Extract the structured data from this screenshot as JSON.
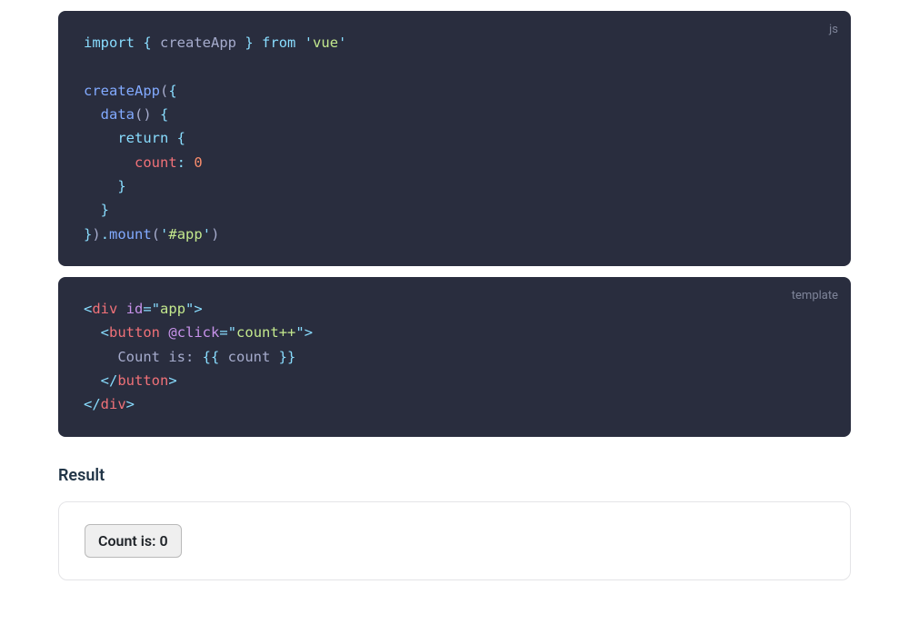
{
  "codeBlocks": {
    "js": {
      "lang": "js",
      "tokens": [
        [
          {
            "t": "keyword",
            "v": "import"
          },
          {
            "t": "default",
            "v": " "
          },
          {
            "t": "punct",
            "v": "{"
          },
          {
            "t": "default",
            "v": " createApp "
          },
          {
            "t": "punct",
            "v": "}"
          },
          {
            "t": "default",
            "v": " "
          },
          {
            "t": "keyword",
            "v": "from"
          },
          {
            "t": "default",
            "v": " "
          },
          {
            "t": "punct",
            "v": "'"
          },
          {
            "t": "string",
            "v": "vue"
          },
          {
            "t": "punct",
            "v": "'"
          }
        ],
        [],
        [
          {
            "t": "func",
            "v": "createApp"
          },
          {
            "t": "default",
            "v": "("
          },
          {
            "t": "punct",
            "v": "{"
          }
        ],
        [
          {
            "t": "default",
            "v": "  "
          },
          {
            "t": "func",
            "v": "data"
          },
          {
            "t": "default",
            "v": "()"
          },
          {
            "t": "default",
            "v": " "
          },
          {
            "t": "punct",
            "v": "{"
          }
        ],
        [
          {
            "t": "default",
            "v": "    "
          },
          {
            "t": "keyword",
            "v": "return"
          },
          {
            "t": "default",
            "v": " "
          },
          {
            "t": "punct",
            "v": "{"
          }
        ],
        [
          {
            "t": "default",
            "v": "      "
          },
          {
            "t": "prop",
            "v": "count"
          },
          {
            "t": "punct",
            "v": ":"
          },
          {
            "t": "default",
            "v": " "
          },
          {
            "t": "num",
            "v": "0"
          }
        ],
        [
          {
            "t": "default",
            "v": "    "
          },
          {
            "t": "punct",
            "v": "}"
          }
        ],
        [
          {
            "t": "default",
            "v": "  "
          },
          {
            "t": "punct",
            "v": "}"
          }
        ],
        [
          {
            "t": "punct",
            "v": "}"
          },
          {
            "t": "default",
            "v": ")"
          },
          {
            "t": "punct",
            "v": "."
          },
          {
            "t": "func",
            "v": "mount"
          },
          {
            "t": "default",
            "v": "("
          },
          {
            "t": "punct",
            "v": "'"
          },
          {
            "t": "string",
            "v": "#app"
          },
          {
            "t": "punct",
            "v": "'"
          },
          {
            "t": "default",
            "v": ")"
          }
        ]
      ]
    },
    "template": {
      "lang": "template",
      "tokens": [
        [
          {
            "t": "tagbr",
            "v": "<"
          },
          {
            "t": "tagname",
            "v": "div"
          },
          {
            "t": "default",
            "v": " "
          },
          {
            "t": "attr",
            "v": "id"
          },
          {
            "t": "tagbr",
            "v": "="
          },
          {
            "t": "tagbr",
            "v": "\""
          },
          {
            "t": "string",
            "v": "app"
          },
          {
            "t": "tagbr",
            "v": "\""
          },
          {
            "t": "tagbr",
            "v": ">"
          }
        ],
        [
          {
            "t": "default",
            "v": "  "
          },
          {
            "t": "tagbr",
            "v": "<"
          },
          {
            "t": "tagname",
            "v": "button"
          },
          {
            "t": "default",
            "v": " "
          },
          {
            "t": "attr",
            "v": "@click"
          },
          {
            "t": "tagbr",
            "v": "="
          },
          {
            "t": "tagbr",
            "v": "\""
          },
          {
            "t": "string",
            "v": "count++"
          },
          {
            "t": "tagbr",
            "v": "\""
          },
          {
            "t": "tagbr",
            "v": ">"
          }
        ],
        [
          {
            "t": "default",
            "v": "    "
          },
          {
            "t": "text",
            "v": "Count is: "
          },
          {
            "t": "punct",
            "v": "{{"
          },
          {
            "t": "text",
            "v": " count "
          },
          {
            "t": "punct",
            "v": "}}"
          }
        ],
        [
          {
            "t": "default",
            "v": "  "
          },
          {
            "t": "tagbr",
            "v": "</"
          },
          {
            "t": "tagname",
            "v": "button"
          },
          {
            "t": "tagbr",
            "v": ">"
          }
        ],
        [
          {
            "t": "tagbr",
            "v": "</"
          },
          {
            "t": "tagname",
            "v": "div"
          },
          {
            "t": "tagbr",
            "v": ">"
          }
        ]
      ]
    }
  },
  "result": {
    "heading": "Result",
    "buttonLabel": "Count is: 0"
  }
}
